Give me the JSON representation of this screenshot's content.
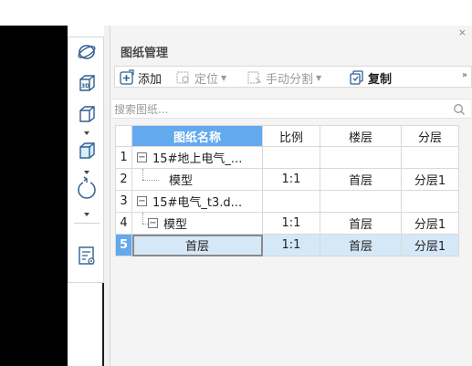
{
  "panel": {
    "title": "图纸管理",
    "close_glyph": "×"
  },
  "toolbar": {
    "add_label": "添加",
    "locate_label": "定位",
    "split_label": "手动分割",
    "copy_label": "复制",
    "more_glyph": "»"
  },
  "search": {
    "placeholder": "搜索图纸..."
  },
  "table": {
    "headers": {
      "name": "图纸名称",
      "scale": "比例",
      "floor": "楼层",
      "layer": "分层"
    },
    "rows": [
      {
        "num": "1",
        "expander": "−",
        "name": "15#地上电气_...",
        "scale": "",
        "floor": "",
        "layer": ""
      },
      {
        "num": "2",
        "expander": "",
        "name": "模型",
        "scale": "1:1",
        "floor": "首层",
        "layer": "分层1"
      },
      {
        "num": "3",
        "expander": "−",
        "name": "15#电气_t3.d...",
        "scale": "",
        "floor": "",
        "layer": ""
      },
      {
        "num": "4",
        "expander": "−",
        "name": "模型",
        "scale": "1:1",
        "floor": "首层",
        "layer": "分层1"
      },
      {
        "num": "5",
        "expander": "",
        "name": "首层",
        "scale": "1:1",
        "floor": "首层",
        "layer": "分层1"
      }
    ],
    "selected_row": 5
  },
  "colors": {
    "header_selected": "#63a9ee",
    "row_selected": "#d5e8f8"
  }
}
